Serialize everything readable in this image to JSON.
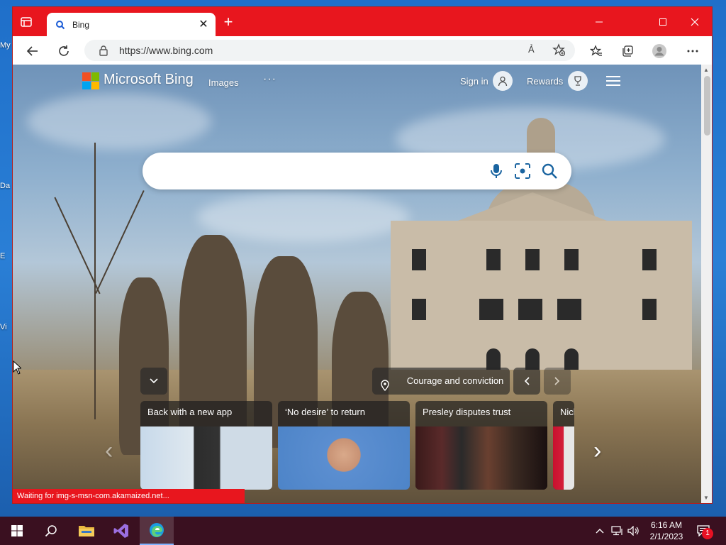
{
  "desktop": {
    "fragments": [
      "My",
      "Da",
      "E",
      "Vi"
    ]
  },
  "browser": {
    "tab": {
      "title": "Bing",
      "close": "✕"
    },
    "new_tab": "+",
    "address": {
      "url": "https://www.bing.com",
      "read_aloud": "Ả"
    },
    "status": "Waiting for img-s-msn-com.akamaized.net..."
  },
  "bing": {
    "brand": "Microsoft Bing",
    "nav": {
      "images": "Images",
      "more": "···"
    },
    "sign_in": "Sign in",
    "rewards": "Rewards",
    "search": {
      "value": "",
      "placeholder": ""
    },
    "caption": "Courage and conviction",
    "cards": [
      {
        "title": "Back with a new app"
      },
      {
        "title": "‘No desire’ to return"
      },
      {
        "title": "Presley disputes trust"
      },
      {
        "title": "Nicl"
      }
    ],
    "carousel_prev": "‹",
    "carousel_next": "›"
  },
  "taskbar": {
    "clock_time": "6:16 AM",
    "clock_date": "2/1/2023",
    "notification_count": "1"
  },
  "colors": {
    "edge_red": "#e8161e",
    "taskbar": "#3a1020"
  }
}
